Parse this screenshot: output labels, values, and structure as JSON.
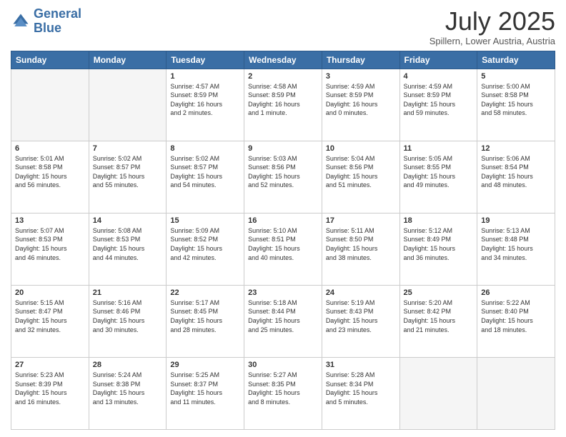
{
  "header": {
    "logo_line1": "General",
    "logo_line2": "Blue",
    "month": "July 2025",
    "location": "Spillern, Lower Austria, Austria"
  },
  "weekdays": [
    "Sunday",
    "Monday",
    "Tuesday",
    "Wednesday",
    "Thursday",
    "Friday",
    "Saturday"
  ],
  "weeks": [
    [
      {
        "day": "",
        "info": ""
      },
      {
        "day": "",
        "info": ""
      },
      {
        "day": "1",
        "info": "Sunrise: 4:57 AM\nSunset: 8:59 PM\nDaylight: 16 hours\nand 2 minutes."
      },
      {
        "day": "2",
        "info": "Sunrise: 4:58 AM\nSunset: 8:59 PM\nDaylight: 16 hours\nand 1 minute."
      },
      {
        "day": "3",
        "info": "Sunrise: 4:59 AM\nSunset: 8:59 PM\nDaylight: 16 hours\nand 0 minutes."
      },
      {
        "day": "4",
        "info": "Sunrise: 4:59 AM\nSunset: 8:59 PM\nDaylight: 15 hours\nand 59 minutes."
      },
      {
        "day": "5",
        "info": "Sunrise: 5:00 AM\nSunset: 8:58 PM\nDaylight: 15 hours\nand 58 minutes."
      }
    ],
    [
      {
        "day": "6",
        "info": "Sunrise: 5:01 AM\nSunset: 8:58 PM\nDaylight: 15 hours\nand 56 minutes."
      },
      {
        "day": "7",
        "info": "Sunrise: 5:02 AM\nSunset: 8:57 PM\nDaylight: 15 hours\nand 55 minutes."
      },
      {
        "day": "8",
        "info": "Sunrise: 5:02 AM\nSunset: 8:57 PM\nDaylight: 15 hours\nand 54 minutes."
      },
      {
        "day": "9",
        "info": "Sunrise: 5:03 AM\nSunset: 8:56 PM\nDaylight: 15 hours\nand 52 minutes."
      },
      {
        "day": "10",
        "info": "Sunrise: 5:04 AM\nSunset: 8:56 PM\nDaylight: 15 hours\nand 51 minutes."
      },
      {
        "day": "11",
        "info": "Sunrise: 5:05 AM\nSunset: 8:55 PM\nDaylight: 15 hours\nand 49 minutes."
      },
      {
        "day": "12",
        "info": "Sunrise: 5:06 AM\nSunset: 8:54 PM\nDaylight: 15 hours\nand 48 minutes."
      }
    ],
    [
      {
        "day": "13",
        "info": "Sunrise: 5:07 AM\nSunset: 8:53 PM\nDaylight: 15 hours\nand 46 minutes."
      },
      {
        "day": "14",
        "info": "Sunrise: 5:08 AM\nSunset: 8:53 PM\nDaylight: 15 hours\nand 44 minutes."
      },
      {
        "day": "15",
        "info": "Sunrise: 5:09 AM\nSunset: 8:52 PM\nDaylight: 15 hours\nand 42 minutes."
      },
      {
        "day": "16",
        "info": "Sunrise: 5:10 AM\nSunset: 8:51 PM\nDaylight: 15 hours\nand 40 minutes."
      },
      {
        "day": "17",
        "info": "Sunrise: 5:11 AM\nSunset: 8:50 PM\nDaylight: 15 hours\nand 38 minutes."
      },
      {
        "day": "18",
        "info": "Sunrise: 5:12 AM\nSunset: 8:49 PM\nDaylight: 15 hours\nand 36 minutes."
      },
      {
        "day": "19",
        "info": "Sunrise: 5:13 AM\nSunset: 8:48 PM\nDaylight: 15 hours\nand 34 minutes."
      }
    ],
    [
      {
        "day": "20",
        "info": "Sunrise: 5:15 AM\nSunset: 8:47 PM\nDaylight: 15 hours\nand 32 minutes."
      },
      {
        "day": "21",
        "info": "Sunrise: 5:16 AM\nSunset: 8:46 PM\nDaylight: 15 hours\nand 30 minutes."
      },
      {
        "day": "22",
        "info": "Sunrise: 5:17 AM\nSunset: 8:45 PM\nDaylight: 15 hours\nand 28 minutes."
      },
      {
        "day": "23",
        "info": "Sunrise: 5:18 AM\nSunset: 8:44 PM\nDaylight: 15 hours\nand 25 minutes."
      },
      {
        "day": "24",
        "info": "Sunrise: 5:19 AM\nSunset: 8:43 PM\nDaylight: 15 hours\nand 23 minutes."
      },
      {
        "day": "25",
        "info": "Sunrise: 5:20 AM\nSunset: 8:42 PM\nDaylight: 15 hours\nand 21 minutes."
      },
      {
        "day": "26",
        "info": "Sunrise: 5:22 AM\nSunset: 8:40 PM\nDaylight: 15 hours\nand 18 minutes."
      }
    ],
    [
      {
        "day": "27",
        "info": "Sunrise: 5:23 AM\nSunset: 8:39 PM\nDaylight: 15 hours\nand 16 minutes."
      },
      {
        "day": "28",
        "info": "Sunrise: 5:24 AM\nSunset: 8:38 PM\nDaylight: 15 hours\nand 13 minutes."
      },
      {
        "day": "29",
        "info": "Sunrise: 5:25 AM\nSunset: 8:37 PM\nDaylight: 15 hours\nand 11 minutes."
      },
      {
        "day": "30",
        "info": "Sunrise: 5:27 AM\nSunset: 8:35 PM\nDaylight: 15 hours\nand 8 minutes."
      },
      {
        "day": "31",
        "info": "Sunrise: 5:28 AM\nSunset: 8:34 PM\nDaylight: 15 hours\nand 5 minutes."
      },
      {
        "day": "",
        "info": ""
      },
      {
        "day": "",
        "info": ""
      }
    ]
  ]
}
